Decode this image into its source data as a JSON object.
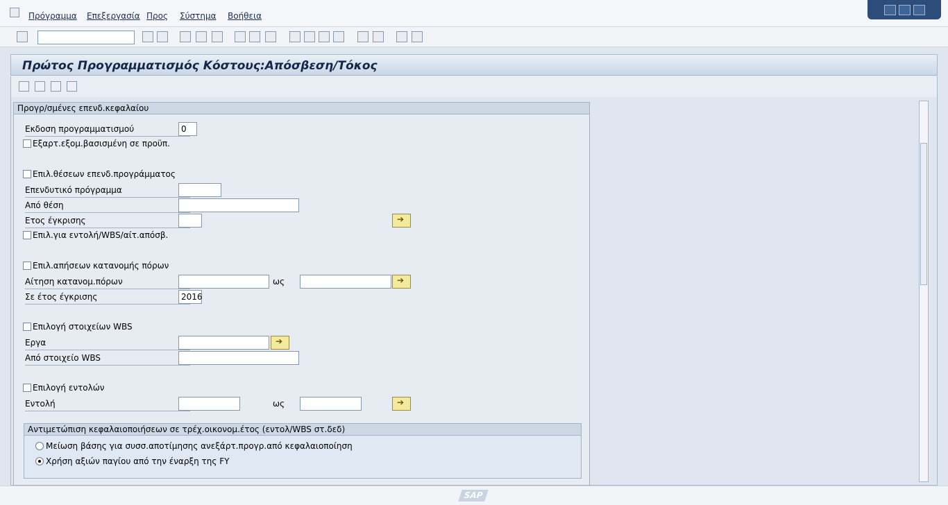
{
  "menu": {
    "items": [
      "Πρόγραμμα",
      "Επεξεργασία",
      "Προς",
      "Σύστημα",
      "Βοήθεια"
    ]
  },
  "command": {
    "value": ""
  },
  "title": "Πρώτος Προγραμματισμός Κόστους:Απόσβεση/Τόκος",
  "group": {
    "header": "Προγρ/σμένες επενδ.κεφαλαίου"
  },
  "fields": {
    "version_label": "Εκδοση προγραμματισμού",
    "version_value": "0",
    "checkbox1": "Εξαρτ.εξομ.βασισμένη σε προϋπ.",
    "checkbox2": "Επιλ.θέσεων επενδ.προγράμματος",
    "invprog_label": "Επενδυτικό πρόγραμμα",
    "from_pos_label": "Από θέση",
    "approval_year_label": "Ετος έγκρισης",
    "checkbox3": "Επιλ.για εντολή/WBS/αίτ.απόσβ.",
    "checkbox4": "Επιλ.απήσεων κατανομής πόρων",
    "request_label": "Αίτηση κατανομ.πόρων",
    "to_label": "ως",
    "in_year_label": "Σε έτος έγκρισης",
    "in_year_value": "2016",
    "checkbox5": "Επιλογή στοιχείων WBS",
    "projects_label": "Εργα",
    "from_wbs_label": "Από στοιχείο WBS",
    "checkbox6": "Επιλογή εντολών",
    "order_label": "Εντολή"
  },
  "subgroup": {
    "header": "Αντιμετώπιση κεφαλαιοποιήσεων σε τρέχ.οικονομ.έτος (εντολ/WBS στ.δεδ)",
    "opt1": "Μείωση βάσης για συσσ.αποτίμησης ανεξάρτ.προγρ.από κεφαλαιοποίηση",
    "opt2": "Χρήση αξιών παγίου από την έναρξη της FY"
  },
  "status": {
    "logo": "SAP"
  }
}
